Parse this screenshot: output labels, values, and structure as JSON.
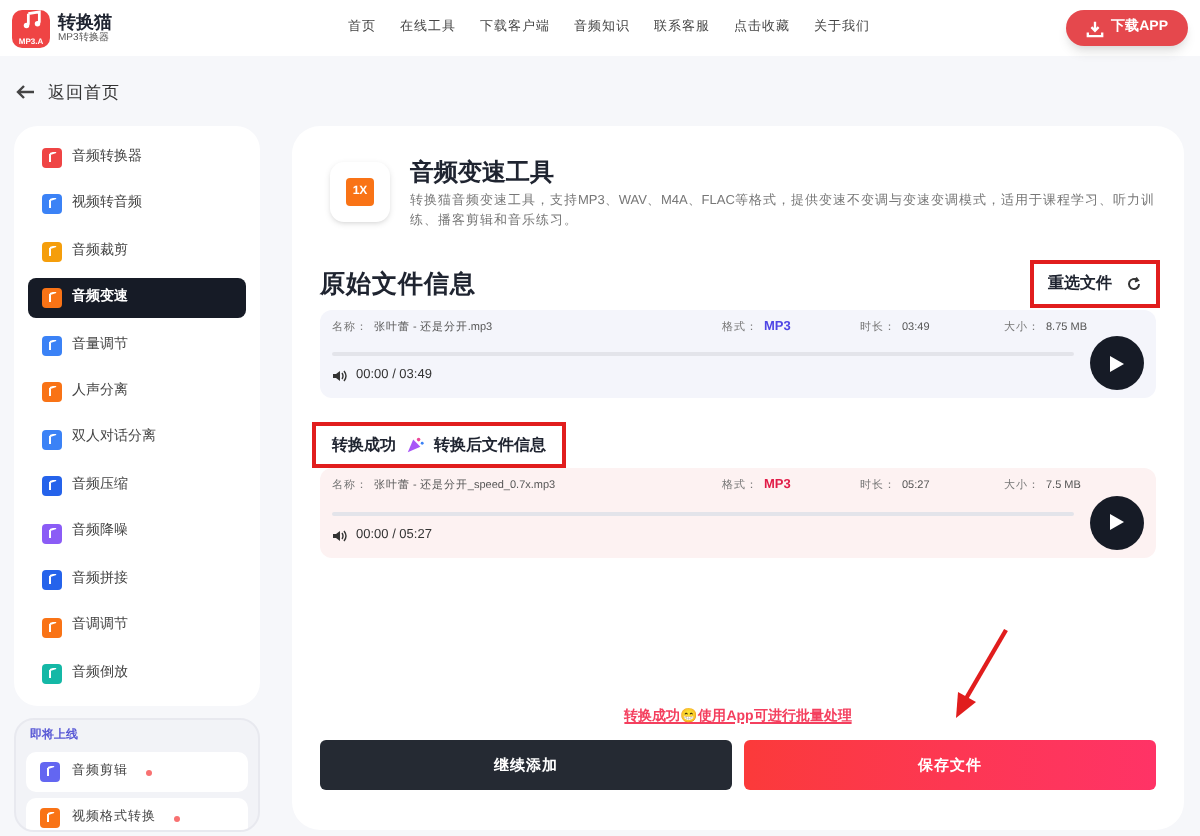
{
  "header": {
    "logo_title": "转换猫",
    "logo_subtitle": "MP3转换器",
    "logo_badge": "MP3.A",
    "nav": [
      "首页",
      "在线工具",
      "下载客户端",
      "音频知识",
      "联系客服",
      "点击收藏",
      "关于我们"
    ],
    "download_button": "下载APP"
  },
  "back_link": "返回首页",
  "sidebar": {
    "items": [
      {
        "label": "音频转换器",
        "selected": false,
        "color": "#ef4444"
      },
      {
        "label": "视频转音频",
        "selected": false,
        "color": "#3b82f6"
      },
      {
        "label": "音频裁剪",
        "selected": false,
        "color": "#f59e0b"
      },
      {
        "label": "音频变速",
        "selected": true,
        "color": "#f97316"
      },
      {
        "label": "音量调节",
        "selected": false,
        "color": "#3b82f6"
      },
      {
        "label": "人声分离",
        "selected": false,
        "color": "#f97316"
      },
      {
        "label": "双人对话分离",
        "selected": false,
        "color": "#3b82f6"
      },
      {
        "label": "音频压缩",
        "selected": false,
        "color": "#2563eb"
      },
      {
        "label": "音频降噪",
        "selected": false,
        "color": "#8b5cf6"
      },
      {
        "label": "音频拼接",
        "selected": false,
        "color": "#2563eb"
      },
      {
        "label": "音调调节",
        "selected": false,
        "color": "#f97316"
      },
      {
        "label": "音频倒放",
        "selected": false,
        "color": "#14b8a6"
      }
    ],
    "coming_soon": {
      "label": "即将上线",
      "items": [
        {
          "label": "音频剪辑",
          "color": "#6366f1"
        },
        {
          "label": "视频格式转换",
          "color": "#f97316"
        }
      ]
    }
  },
  "tool": {
    "icon_text": "1X",
    "title": "音频变速工具",
    "description": "转换猫音频变速工具，支持MP3、WAV、M4A、FLAC等格式，提供变速不变调与变速变调模式，适用于课程学习、听力训练、播客剪辑和音乐练习。"
  },
  "files": [
    {
      "kind": "original",
      "heading": "原始文件信息",
      "action": "重选文件",
      "name_label": "名称：",
      "name": "张叶蕾 - 还是分开.mp3",
      "format_label": "格式：",
      "format": "MP3",
      "duration_label": "时长：",
      "duration": "03:49",
      "size_label": "大小：",
      "size": "8.75 MB",
      "time": "00:00 / 03:49",
      "level": 0
    },
    {
      "kind": "converted",
      "heading_prefix": "转换成功",
      "heading": "转换后文件信息",
      "name_label": "名称：",
      "name": "张叶蕾 - 还是分开_speed_0.7x.mp3",
      "format_label": "格式：",
      "format": "MP3",
      "duration_label": "时长：",
      "duration": "05:27",
      "size_label": "大小：",
      "size": "7.5 MB",
      "time": "00:00 / 05:27",
      "level": 0
    }
  ],
  "notice": "转换成功😁使用App可进行批量处理",
  "buttons": [
    {
      "kind": "secondary",
      "label": "继续添加"
    },
    {
      "kind": "primary",
      "label": "保存文件"
    }
  ]
}
